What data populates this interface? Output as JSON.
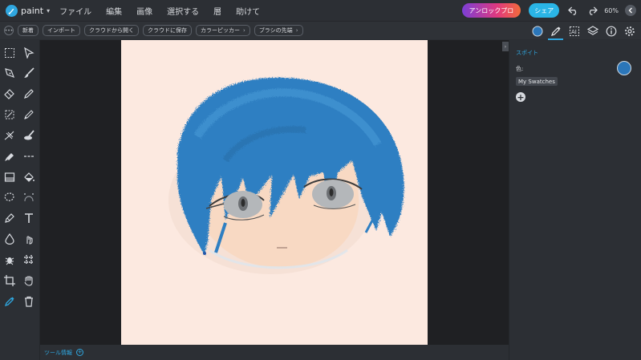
{
  "app": {
    "name": "paint",
    "menu": [
      "ファイル",
      "編集",
      "画像",
      "選択する",
      "層",
      "助けて"
    ],
    "unlock_label": "アンロックプロ",
    "share_label": "シェア",
    "zoom": "60%"
  },
  "toolbar": {
    "buttons": [
      "新着",
      "インポート",
      "クラウドから開く",
      "クラウドに保存",
      "カラーピッカー",
      "ブラシの先端"
    ]
  },
  "bottom": {
    "tool_info_label": "ツール情報"
  },
  "right_panel": {
    "title": "スポイト",
    "color_label": "色:",
    "swatches_label": "My Swatches",
    "current_color": "#2b76b9"
  },
  "colors": {
    "accent": "#2fa7e0",
    "canvas_bg": "#fce9e0",
    "hair": "#2f7fc2",
    "skin": "#f8dcc8"
  }
}
